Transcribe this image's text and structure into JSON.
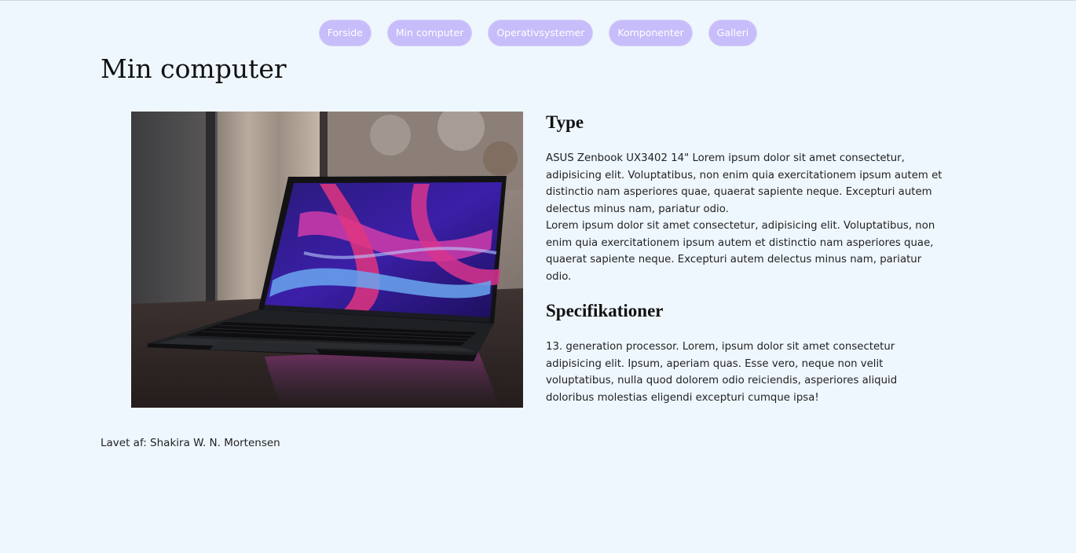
{
  "nav": {
    "items": [
      {
        "label": "Forside"
      },
      {
        "label": "Min computer"
      },
      {
        "label": "Operativsystemer"
      },
      {
        "label": "Komponenter"
      },
      {
        "label": "Galleri"
      }
    ]
  },
  "page": {
    "title": "Min computer"
  },
  "type_section": {
    "heading": "Type",
    "paragraph1": "ASUS Zenbook UX3402 14\" Lorem ipsum dolor sit amet consectetur, adipisicing elit. Voluptatibus, non enim quia exercitationem ipsum autem et distinctio nam asperiores quae, quaerat sapiente neque. Excepturi autem delectus minus nam, pariatur odio.",
    "paragraph2": "Lorem ipsum dolor sit amet consectetur, adipisicing elit. Voluptatibus, non enim quia exercitationem ipsum autem et distinctio nam asperiores quae, quaerat sapiente neque. Excepturi autem delectus minus nam, pariatur odio."
  },
  "spec_section": {
    "heading": "Specifikationer",
    "paragraph": "13. generation processor. Lorem, ipsum dolor sit amet consectetur adipisicing elit. Ipsum, aperiam quas. Esse vero, neque non velit voluptatibus, nulla quod dolorem odio reiciendis, asperiores aliquid doloribus molestias eligendi excepturi cumque ipsa!"
  },
  "footer": {
    "credit": "Lavet af: Shakira W. N. Mortensen"
  },
  "colors": {
    "page_background": "#eff7fe",
    "nav_button_background": "#c7bdfa",
    "nav_button_text": "#ffffff"
  }
}
